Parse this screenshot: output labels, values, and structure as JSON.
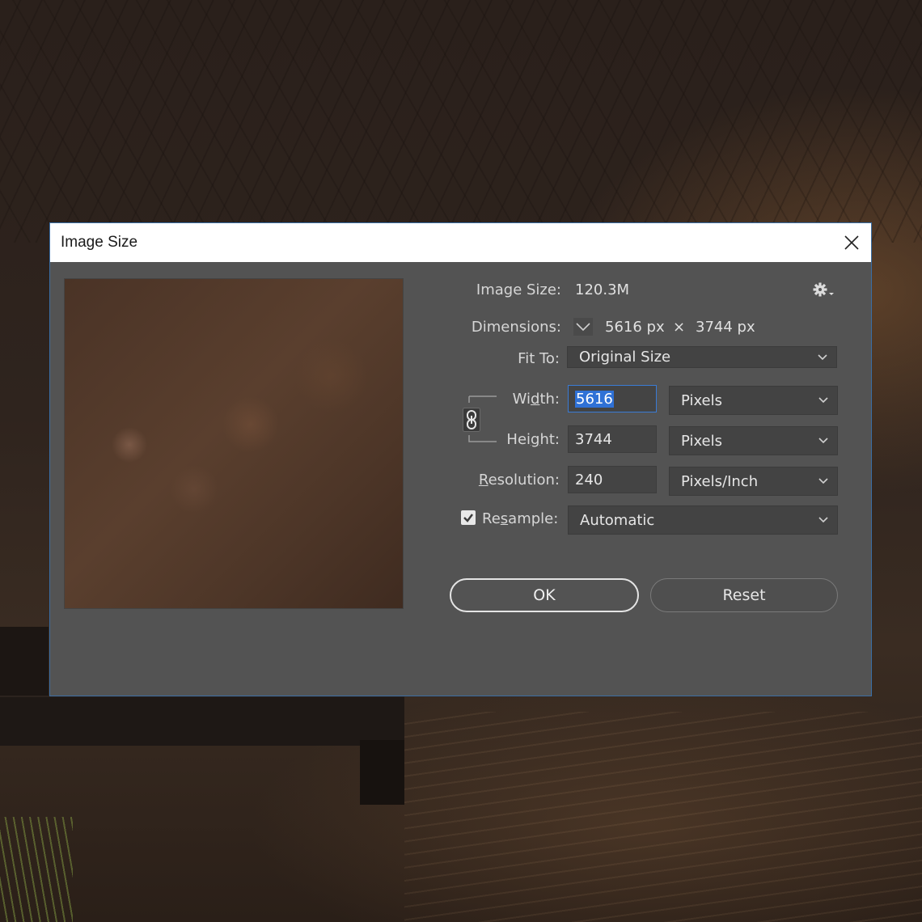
{
  "dialog": {
    "title": "Image Size",
    "image_size_label": "Image Size:",
    "image_size_value": "120.3M",
    "dimensions_label": "Dimensions:",
    "dimensions_width": "5616 px",
    "dimensions_times": "×",
    "dimensions_height": "3744 px",
    "fit_to_label": "Fit To:",
    "fit_to_value": "Original Size",
    "width_label_pre": "Wi",
    "width_label_u": "d",
    "width_label_post": "th:",
    "width_value": "5616",
    "width_unit": "Pixels",
    "height_label_pre": "Hei",
    "height_label_u": "g",
    "height_label_post": "ht:",
    "height_value": "3744",
    "height_unit": "Pixels",
    "resolution_label_u": "R",
    "resolution_label_post": "esolution:",
    "resolution_value": "240",
    "resolution_unit": "Pixels/Inch",
    "resample_label_pre": "Re",
    "resample_label_u": "s",
    "resample_label_post": "ample:",
    "resample_checked": true,
    "resample_method": "Automatic",
    "ok_label": "OK",
    "reset_label": "Reset"
  },
  "icons": {
    "close": "close-icon",
    "gear": "gear-icon",
    "chain": "chain-link-icon",
    "chevron": "chevron-down-icon",
    "checkmark": "checkmark-icon"
  },
  "colors": {
    "dialog_bg": "#535353",
    "field_bg": "#434343",
    "selection_blue": "#2f71d6",
    "focus_border": "#3a7bd5"
  }
}
